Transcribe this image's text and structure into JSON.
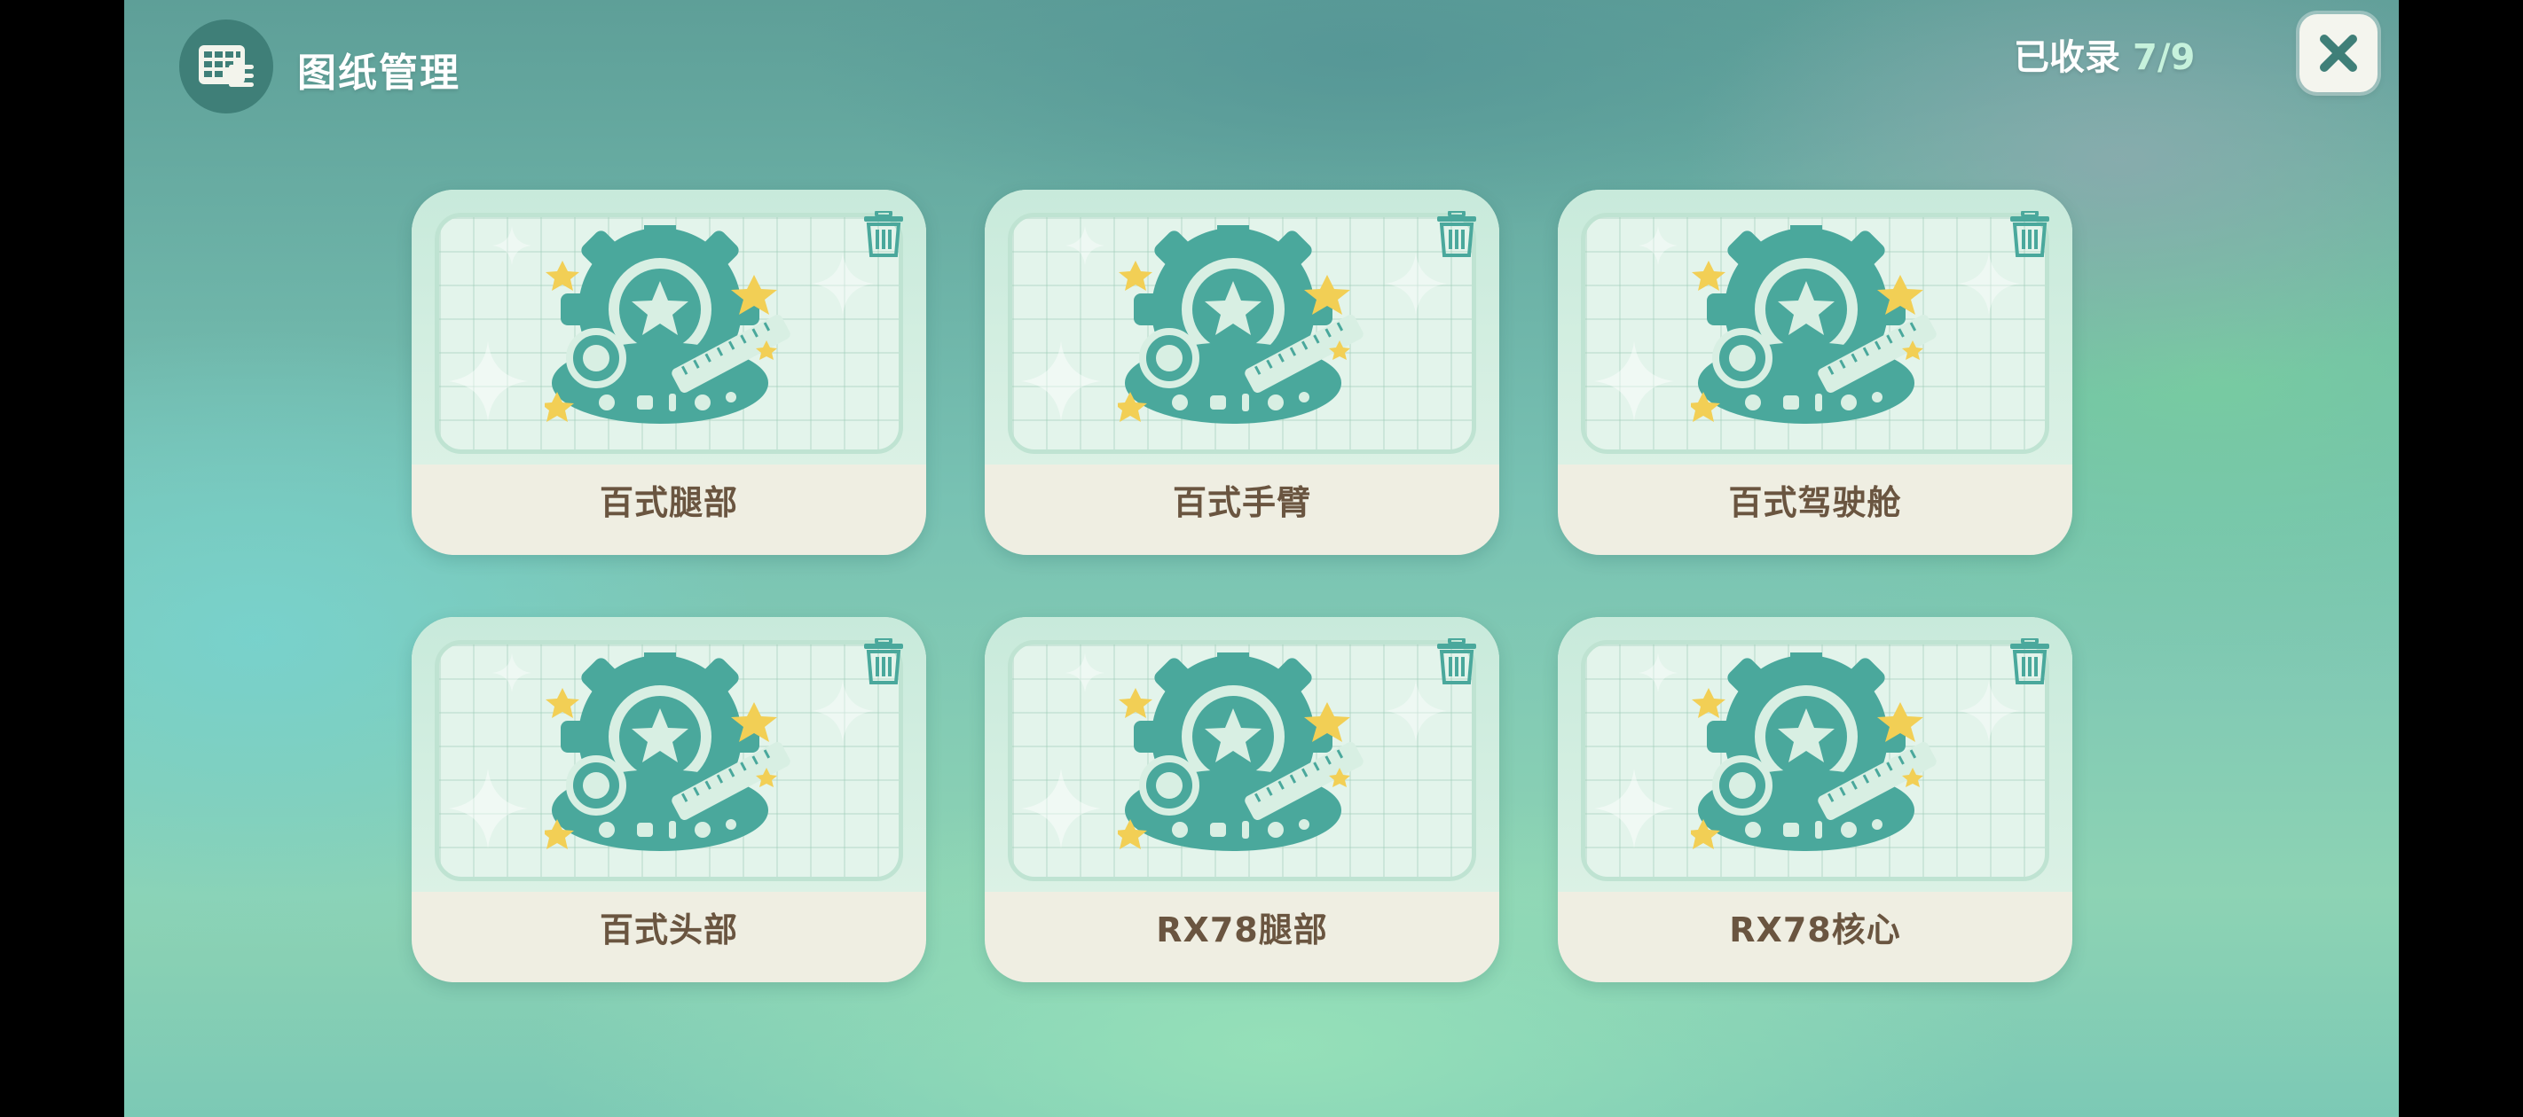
{
  "header": {
    "title": "图纸管理",
    "title_icon": "blueprint-list-icon",
    "collected_label": "已收录",
    "collected_count": "7/9",
    "close_icon": "close-icon"
  },
  "colors": {
    "emblem": "#4aa89c",
    "star": "#f2cf55",
    "card_bg": "#efeee2",
    "label": "#6a5540"
  },
  "cards": [
    {
      "label": "百式腿部",
      "icon": "blueprint-emblem-icon",
      "action_icon": "trash-icon"
    },
    {
      "label": "百式手臂",
      "icon": "blueprint-emblem-icon",
      "action_icon": "trash-icon"
    },
    {
      "label": "百式驾驶舱",
      "icon": "blueprint-emblem-icon",
      "action_icon": "trash-icon"
    },
    {
      "label": "百式头部",
      "icon": "blueprint-emblem-icon",
      "action_icon": "trash-icon"
    },
    {
      "label": "RX78腿部",
      "icon": "blueprint-emblem-icon",
      "action_icon": "trash-icon"
    },
    {
      "label": "RX78核心",
      "icon": "blueprint-emblem-icon",
      "action_icon": "trash-icon"
    }
  ]
}
